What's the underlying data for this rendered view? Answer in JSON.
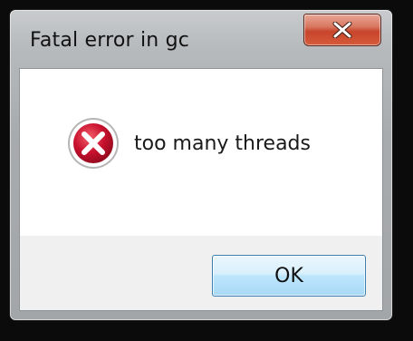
{
  "dialog": {
    "title": "Fatal error in gc",
    "message": "too many threads",
    "ok_label": "OK"
  },
  "icons": {
    "close": "close-icon",
    "error": "error-icon"
  },
  "colors": {
    "close_button": "#c7452b",
    "error_icon": "#c8102e",
    "ok_button_border": "#3c7fb1"
  }
}
